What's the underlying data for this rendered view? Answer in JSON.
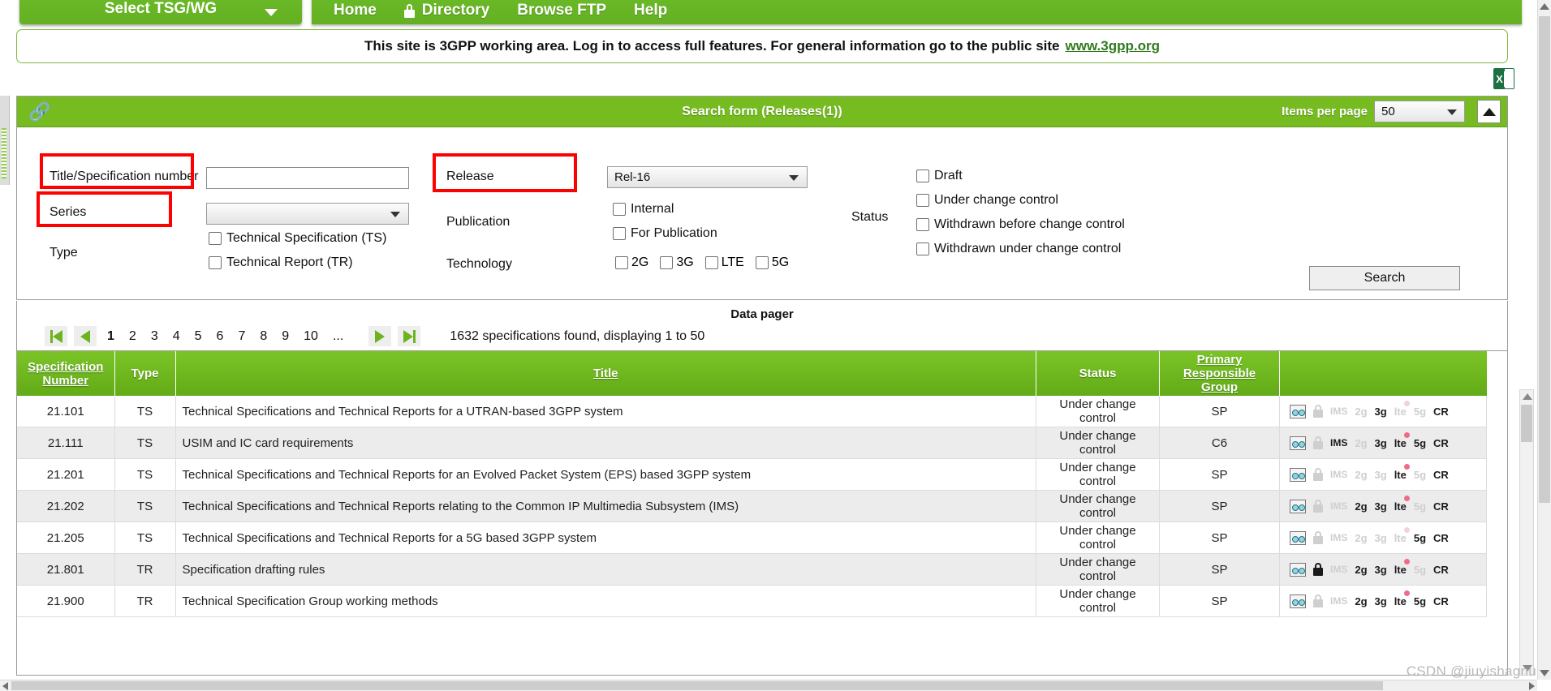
{
  "topnav": {
    "tsg_button": "Select TSG/WG",
    "links": [
      {
        "label": "Home",
        "icon": ""
      },
      {
        "label": "Directory",
        "icon": "lock-icon"
      },
      {
        "label": "Browse FTP",
        "icon": ""
      },
      {
        "label": "Help",
        "icon": ""
      }
    ]
  },
  "banner": {
    "text": "This site is 3GPP working area. Log in to access full features. For general information go to the public site",
    "link": "www.3gpp.org"
  },
  "toolbar": {
    "export_icon": "excel-export-icon",
    "excel_letter": "X"
  },
  "search_form": {
    "title": "Search form (Releases(1))",
    "items_per_page_label": "Items per page",
    "items_per_page_value": "50",
    "collapse_icon": "chevron-up-icon",
    "link_icon": "chain-link-icon",
    "labels": {
      "title_spec_number": "Title/Specification number",
      "series": "Series",
      "type": "Type",
      "release": "Release",
      "publication": "Publication",
      "technology": "Technology",
      "status": "Status"
    },
    "title_spec_value": "",
    "series_value": "",
    "release_value": "Rel-16",
    "type_checkboxes": [
      {
        "label": "Technical Specification (TS)",
        "checked": false
      },
      {
        "label": "Technical Report (TR)",
        "checked": false
      }
    ],
    "publication_checkboxes": [
      {
        "label": "Internal",
        "checked": false
      },
      {
        "label": "For Publication",
        "checked": false
      }
    ],
    "technology_checkboxes": [
      {
        "label": "2G",
        "checked": false
      },
      {
        "label": "3G",
        "checked": false
      },
      {
        "label": "LTE",
        "checked": false
      },
      {
        "label": "5G",
        "checked": false
      }
    ],
    "status_checkboxes": [
      {
        "label": "Draft",
        "checked": false
      },
      {
        "label": "Under change control",
        "checked": false
      },
      {
        "label": "Withdrawn before change control",
        "checked": false
      },
      {
        "label": "Withdrawn under change control",
        "checked": false
      }
    ],
    "search_button": "Search",
    "highlight_color": "#ff0000"
  },
  "pager": {
    "title": "Data pager",
    "first_icon": "first-page-icon",
    "prev_icon": "previous-page-icon",
    "next_icon": "next-page-icon",
    "last_icon": "last-page-icon",
    "pages": [
      "1",
      "2",
      "3",
      "4",
      "5",
      "6",
      "7",
      "8",
      "9",
      "10",
      "..."
    ],
    "current_page": "1",
    "info": "1632 specifications found, displaying 1 to 50"
  },
  "table": {
    "headers": {
      "spec_number": "Specification Number",
      "spec_number_line1": "Specification",
      "spec_number_line2": "Number",
      "type": "Type",
      "title": "Title",
      "status": "Status",
      "group_line1": "Primary",
      "group_line2": "Responsible Group",
      "icons": ""
    },
    "rows": [
      {
        "number": "21.101",
        "type": "TS",
        "title": "Technical Specifications and Technical Reports for a UTRAN-based 3GPP system",
        "status": "Under change control",
        "group": "SP",
        "flags": {
          "spec": true,
          "lock": false,
          "ims": false,
          "g2": false,
          "g3": true,
          "lte": false,
          "g5": false,
          "cr": true
        }
      },
      {
        "number": "21.111",
        "type": "TS",
        "title": "USIM and IC card requirements",
        "status": "Under change control",
        "group": "C6",
        "flags": {
          "spec": true,
          "lock": false,
          "ims": true,
          "g2": false,
          "g3": true,
          "lte": true,
          "g5": true,
          "cr": true
        }
      },
      {
        "number": "21.201",
        "type": "TS",
        "title": "Technical Specifications and Technical Reports for an Evolved Packet System (EPS) based 3GPP system",
        "status": "Under change control",
        "group": "SP",
        "flags": {
          "spec": true,
          "lock": false,
          "ims": false,
          "g2": false,
          "g3": false,
          "lte": true,
          "g5": false,
          "cr": true
        }
      },
      {
        "number": "21.202",
        "type": "TS",
        "title": "Technical Specifications and Technical Reports relating to the Common IP Multimedia Subsystem (IMS)",
        "status": "Under change control",
        "group": "SP",
        "flags": {
          "spec": true,
          "lock": false,
          "ims": false,
          "g2": true,
          "g3": true,
          "lte": true,
          "g5": false,
          "cr": true
        }
      },
      {
        "number": "21.205",
        "type": "TS",
        "title": "Technical Specifications and Technical Reports for a 5G based 3GPP system",
        "status": "Under change control",
        "group": "SP",
        "flags": {
          "spec": true,
          "lock": false,
          "ims": false,
          "g2": false,
          "g3": false,
          "lte": false,
          "g5": true,
          "cr": true
        }
      },
      {
        "number": "21.801",
        "type": "TR",
        "title": "Specification drafting rules",
        "status": "Under change control",
        "group": "SP",
        "flags": {
          "spec": true,
          "lock": true,
          "ims": false,
          "g2": true,
          "g3": true,
          "lte": true,
          "g5": false,
          "cr": true
        }
      },
      {
        "number": "21.900",
        "type": "TR",
        "title": "Technical Specification Group working methods",
        "status": "Under change control",
        "group": "SP",
        "flags": {
          "spec": true,
          "lock": false,
          "ims": false,
          "g2": true,
          "g3": true,
          "lte": true,
          "g5": true,
          "cr": true
        }
      }
    ],
    "icon_labels": {
      "spec": "spec-viewer-icon",
      "lock": "lock-icon",
      "ims": "IMS",
      "g2": "2g",
      "g3": "3g",
      "lte": "lte",
      "g5": "5g",
      "cr": "CR"
    }
  },
  "watermark": "CSDN @jiuyishagnu"
}
